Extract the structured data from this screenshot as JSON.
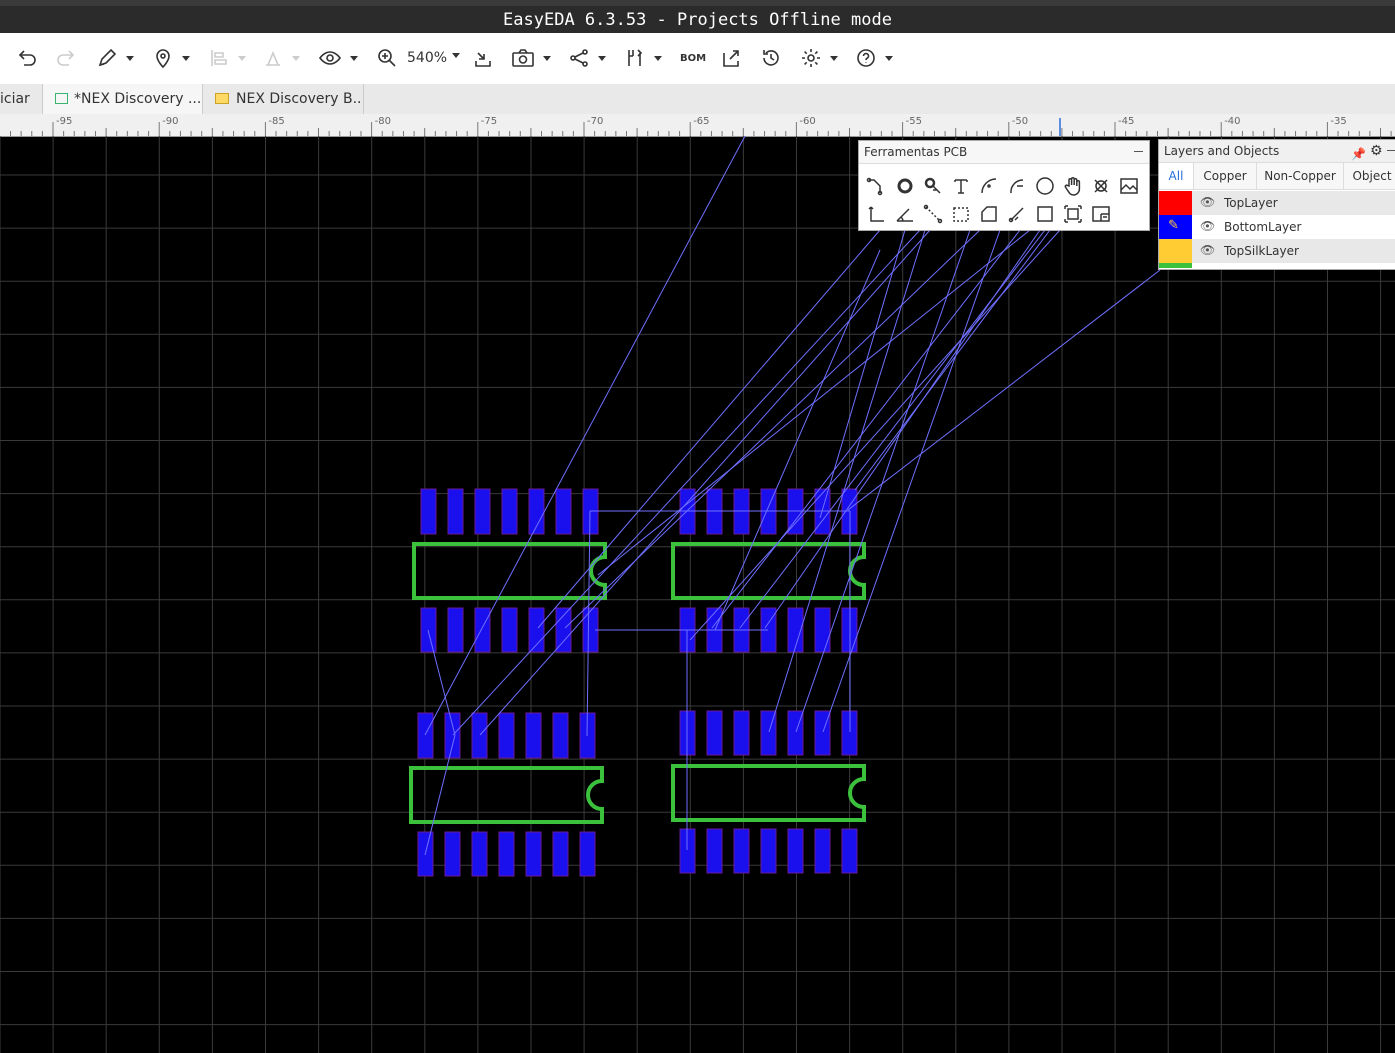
{
  "window": {
    "title": "EasyEDA 6.3.53 - Projects Offline mode"
  },
  "toolbar": {
    "zoom": "540%",
    "bom": "BOM"
  },
  "tabs": [
    {
      "label": "iciar"
    },
    {
      "label": "*NEX Discovery ..."
    },
    {
      "label": "NEX Discovery B..."
    }
  ],
  "ruler": {
    "labels": [
      "-95",
      "-90",
      "-85",
      "-80",
      "-75",
      "-70",
      "-65",
      "-60",
      "-55",
      "-50",
      "-45",
      "-40",
      "-35"
    ]
  },
  "pcb_tools": {
    "title": "Ferramentas PCB"
  },
  "layers_panel": {
    "title": "Layers and Objects",
    "tabs": [
      "All",
      "Copper",
      "Non-Copper",
      "Object"
    ],
    "layers": [
      {
        "name": "TopLayer",
        "color": "#ff0000"
      },
      {
        "name": "BottomLayer",
        "color": "#0000ff"
      },
      {
        "name": "TopSilkLayer",
        "color": "#ffcc33"
      }
    ]
  },
  "colors": {
    "pad": "#1a10ee",
    "silk": "#3cc13c",
    "ratline": "#6f6fff",
    "grid": "#3a3a3a"
  }
}
